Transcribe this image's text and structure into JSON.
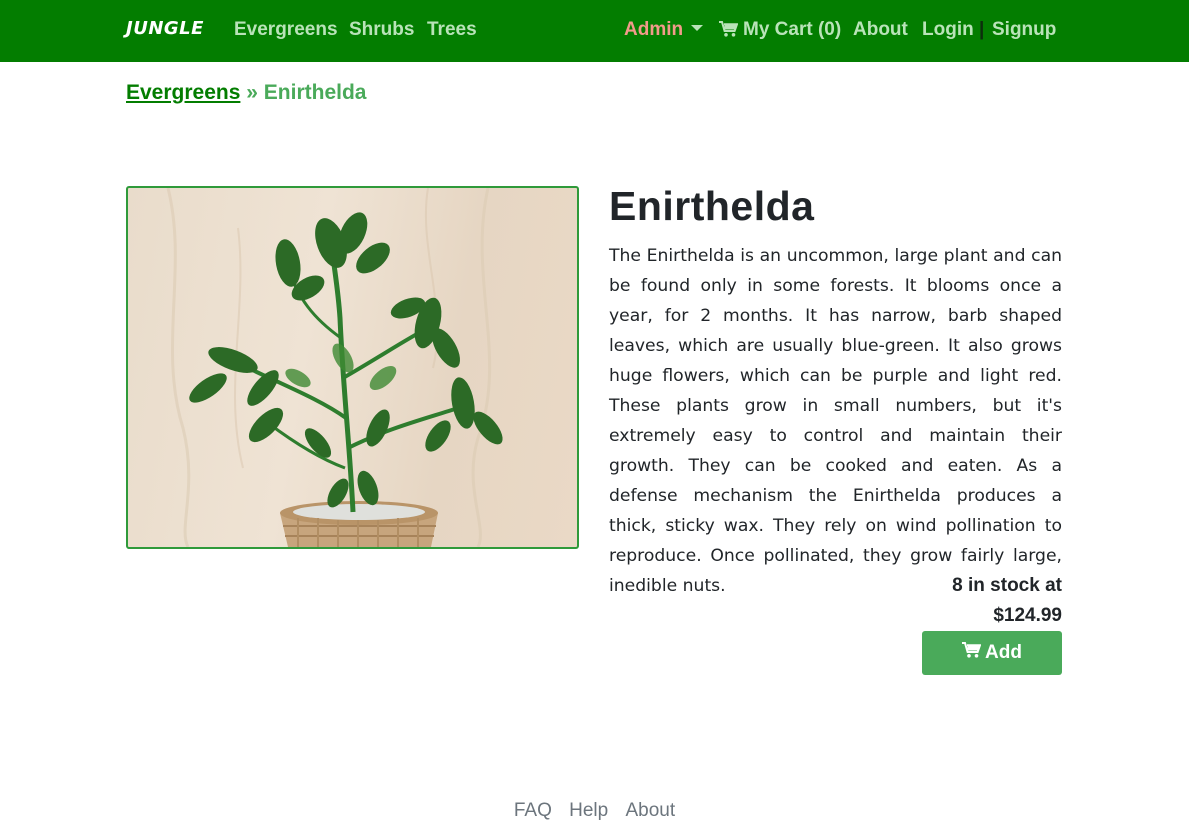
{
  "navbar": {
    "brand": "JUNGLE",
    "categories": [
      "Evergreens",
      "Shrubs",
      "Trees"
    ],
    "admin_label": "Admin",
    "cart_label": "My Cart (0)",
    "about_label": "About",
    "login_label": "Login",
    "separator": "|",
    "signup_label": "Signup",
    "colors": {
      "background": "#037d00",
      "link": "#b9e3b8",
      "admin": "#f29b8a"
    }
  },
  "breadcrumb": {
    "parent": "Evergreens",
    "separator": "»",
    "current": "Enirthelda"
  },
  "product": {
    "name": "Enirthelda",
    "description": "The Enirthelda is an uncommon, large plant and can be found only in some forests. It blooms once a year, for 2 months. It has narrow, barb shaped leaves, which are usually blue-green. It also grows huge flowers, which can be purple and light red. These plants grow in small numbers, but it's extremely easy to control and maintain their growth. They can be cooked and eaten. As a defense mechanism the Enirthelda produces a thick, sticky wax. They rely on wind pollination to reproduce. Once pollinated, they grow fairly large, inedible nuts.",
    "stock_text": "8 in stock at",
    "price": "$124.99",
    "add_label": "Add",
    "image_icon": "potted-plant-photo"
  },
  "footer": {
    "links": [
      "FAQ",
      "Help",
      "About"
    ]
  }
}
